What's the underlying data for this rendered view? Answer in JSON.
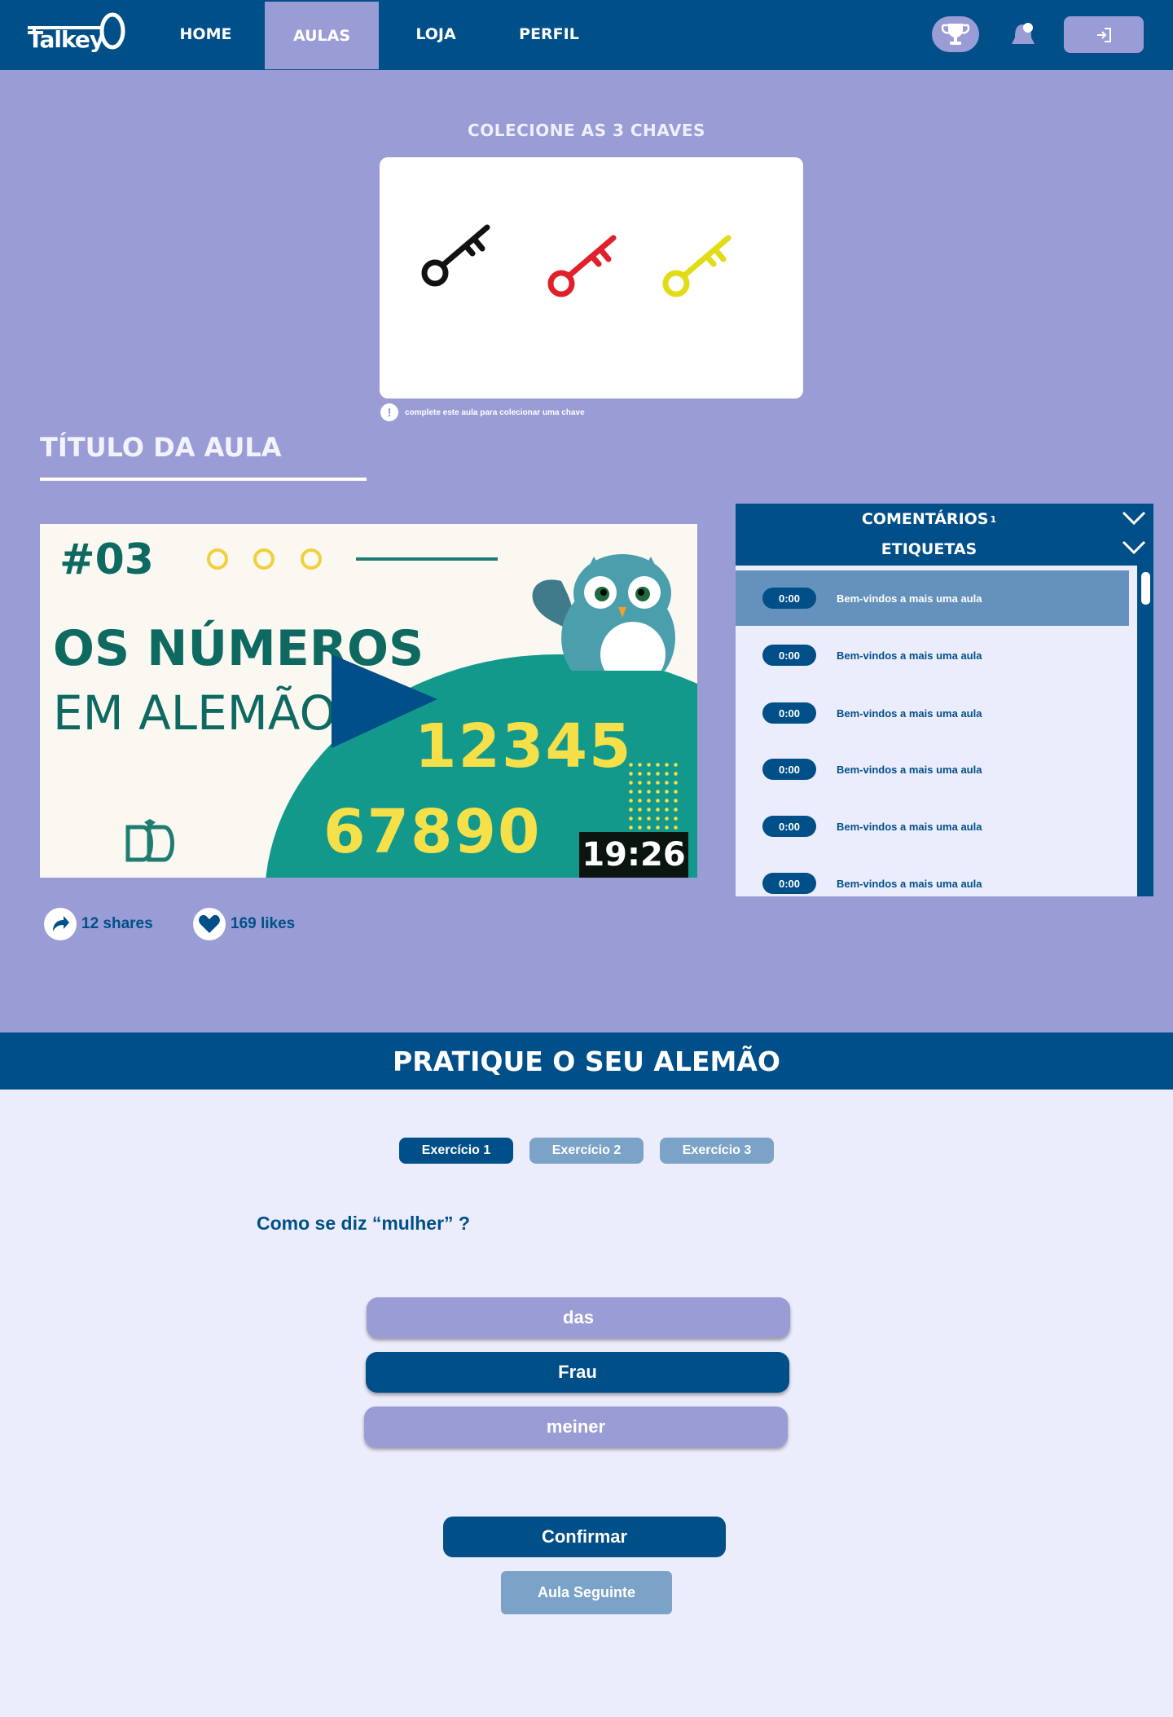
{
  "nav": {
    "logo": "Talkey",
    "items": [
      {
        "label": "HOME",
        "active": false
      },
      {
        "label": "AULAS",
        "active": true
      },
      {
        "label": "LOJA",
        "active": false
      },
      {
        "label": "PERFIL",
        "active": false
      }
    ],
    "icons": [
      "trophy-icon",
      "bell-icon",
      "logout-icon"
    ]
  },
  "keys": {
    "title": "COLECIONE AS 3  CHAVES",
    "key_colors": [
      "#111111",
      "#e0202a",
      "#e2dc18"
    ],
    "hint": "complete este aula para colecionar uma chave"
  },
  "lesson": {
    "title": "TÍTULO DA AULA",
    "video": {
      "episode": "#03",
      "line1": "OS NÚMEROS",
      "line2": "EM ALEMÃO",
      "numbers1": "12345",
      "numbers2": "67890",
      "duration": "19:26"
    },
    "shares": "12 shares",
    "likes": "169 likes"
  },
  "panel": {
    "comments_label": "COMENTÁRIOS",
    "comments_count": "1",
    "tags_label": "ETIQUETAS",
    "tags": [
      {
        "time": "0:00",
        "text": "Bem-vindos a mais uma aula"
      },
      {
        "time": "0:00",
        "text": "Bem-vindos a mais uma aula"
      },
      {
        "time": "0:00",
        "text": "Bem-vindos a mais uma aula"
      },
      {
        "time": "0:00",
        "text": "Bem-vindos a mais uma aula"
      },
      {
        "time": "0:00",
        "text": "Bem-vindos a mais uma aula"
      },
      {
        "time": "0:00",
        "text": "Bem-vindos a mais uma aula"
      }
    ]
  },
  "practice": {
    "title": "PRATIQUE O SEU ALEMÃO",
    "tabs": [
      "Exercício 1",
      "Exercício 2",
      "Exercício 3"
    ],
    "question": "Como se diz “mulher” ?",
    "options": [
      "das",
      "Frau",
      "meiner"
    ],
    "selected_option": "Frau",
    "confirm": "Confirmar",
    "next": "Aula Seguinte"
  },
  "colors": {
    "primary": "#004f88",
    "lavender": "#9a9cd5",
    "light_bg": "#ecedfc",
    "muted_blue": "#7ba2c7"
  }
}
